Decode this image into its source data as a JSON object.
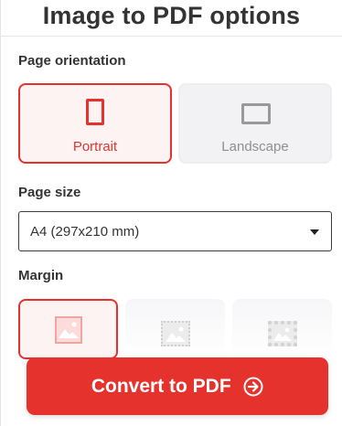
{
  "header": {
    "title": "Image to PDF options"
  },
  "orientation": {
    "label": "Page orientation",
    "selected": "Portrait",
    "options": [
      {
        "label": "Portrait",
        "icon": "portrait-page-icon"
      },
      {
        "label": "Landscape",
        "icon": "landscape-page-icon"
      }
    ]
  },
  "page_size": {
    "label": "Page size",
    "selected_value": "A4 (297x210 mm)",
    "icon": "chevron-down-icon"
  },
  "margin": {
    "label": "Margin",
    "options": [
      {
        "name": "no-margin",
        "icon": "image-icon"
      },
      {
        "name": "small-margin",
        "icon": "image-icon"
      },
      {
        "name": "big-margin",
        "icon": "image-icon"
      }
    ],
    "selected": "no-margin"
  },
  "action": {
    "convert_label": "Convert to PDF",
    "icon": "arrow-right-circle-icon"
  },
  "colors": {
    "accent": "#e5322d",
    "selected_bg": "#fdf3f3",
    "unselected_bg": "#f2f2f4",
    "text": "#333333",
    "muted_text": "#8f8f8f"
  }
}
